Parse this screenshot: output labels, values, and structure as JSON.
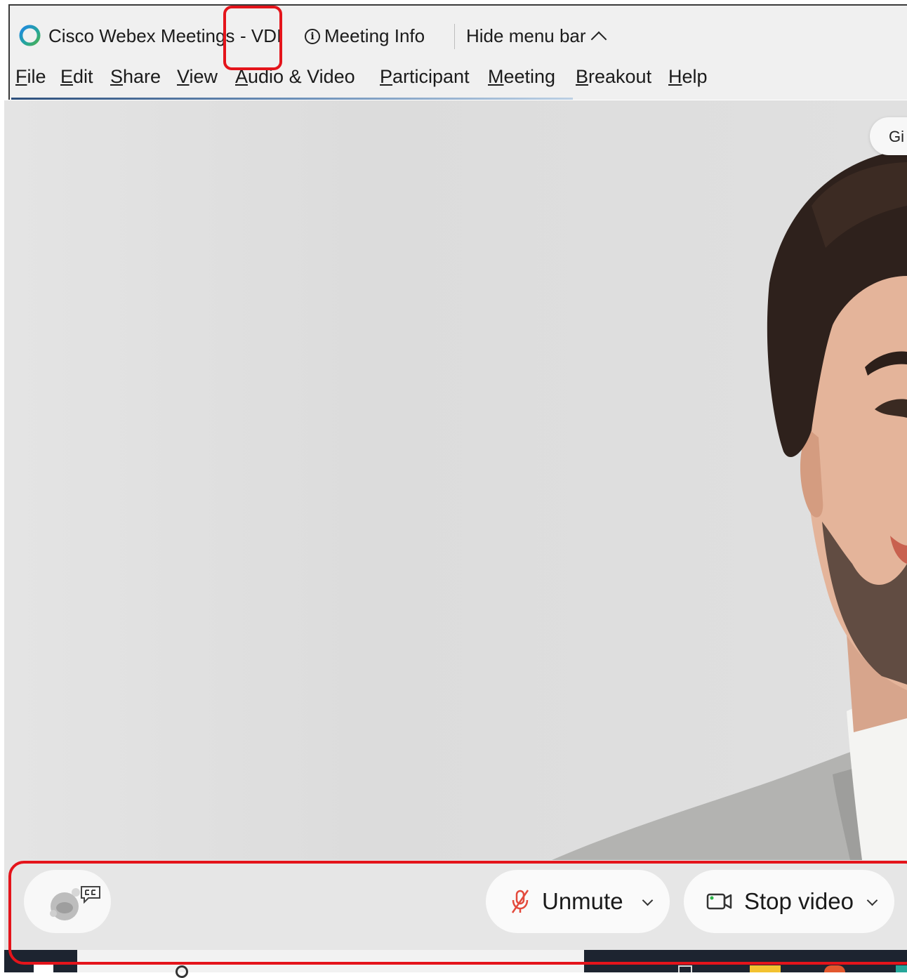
{
  "window": {
    "app_title": "Cisco Webex Meetings",
    "vdi_suffix": "- VDI",
    "meeting_info": "Meeting Info",
    "hide_menu_bar": "Hide menu bar"
  },
  "menu": {
    "file": {
      "acc": "F",
      "rest": "ile"
    },
    "edit": {
      "acc": "E",
      "rest": "dit"
    },
    "share": {
      "acc": "S",
      "rest": "hare"
    },
    "view": {
      "acc": "V",
      "rest": "iew"
    },
    "audio_video": {
      "acc": "A",
      "rest": "udio & Video"
    },
    "participant": {
      "acc": "P",
      "rest": "articipant"
    },
    "meeting": {
      "acc": "M",
      "rest": "eeting"
    },
    "breakout": {
      "acc": "B",
      "rest": "reakout"
    },
    "help": {
      "acc": "H",
      "rest": "elp"
    }
  },
  "video": {
    "name_tag": "Gi"
  },
  "controls": {
    "unmute": "Unmute",
    "stop_video": "Stop video",
    "mic_state": "muted",
    "camera_state": "on"
  },
  "colors": {
    "annotation": "#e4141b",
    "mic_muted": "#e34a3c",
    "camera_active": "#2bb44a",
    "webex_blue": "#1e88e5",
    "webex_green": "#4caf50"
  },
  "icons": {
    "app": "webex-logo-icon",
    "info": "info-icon",
    "hide_menu": "chevron-up-icon",
    "mic": "microphone-muted-icon",
    "camera": "video-camera-icon",
    "assistant": "ai-assistant-icon",
    "captions": "closed-captions-icon"
  }
}
